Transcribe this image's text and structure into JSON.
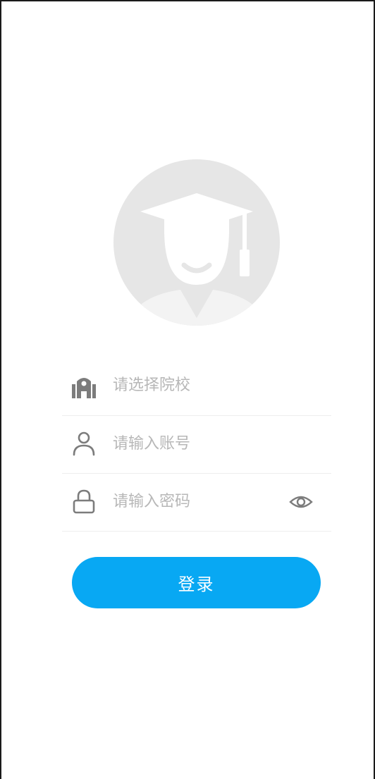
{
  "avatar": {
    "icon": "graduate-avatar-icon",
    "bg_color": "#e6e6e6",
    "fg_color": "#ffffff"
  },
  "school": {
    "icon": "school-building-icon",
    "label": "请选择院校"
  },
  "account": {
    "icon": "user-icon",
    "placeholder": "请输入账号",
    "value": ""
  },
  "password": {
    "icon": "lock-icon",
    "placeholder": "请输入密码",
    "value": "",
    "toggle_icon": "eye-icon"
  },
  "login": {
    "label": "登录",
    "color": "#08a8f3"
  }
}
